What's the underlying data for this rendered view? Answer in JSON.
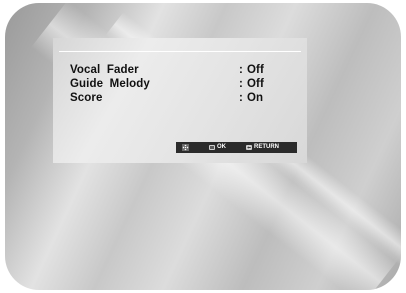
{
  "menu": {
    "items": [
      {
        "label": "Vocal  Fader",
        "value": "Off"
      },
      {
        "label": "Guide  Melody",
        "value": "Off"
      },
      {
        "label": "Score",
        "value": "On"
      }
    ],
    "separator": ":"
  },
  "navbar": {
    "ok_label": "OK",
    "return_label": "RETURN"
  },
  "colors": {
    "panel": "#e6e6e6",
    "navbar": "#2b2b2b",
    "text": "#111111"
  },
  "icons": {
    "navigate": "directional-pad-icon",
    "ok": "ok-button-icon",
    "return": "return-button-icon"
  }
}
